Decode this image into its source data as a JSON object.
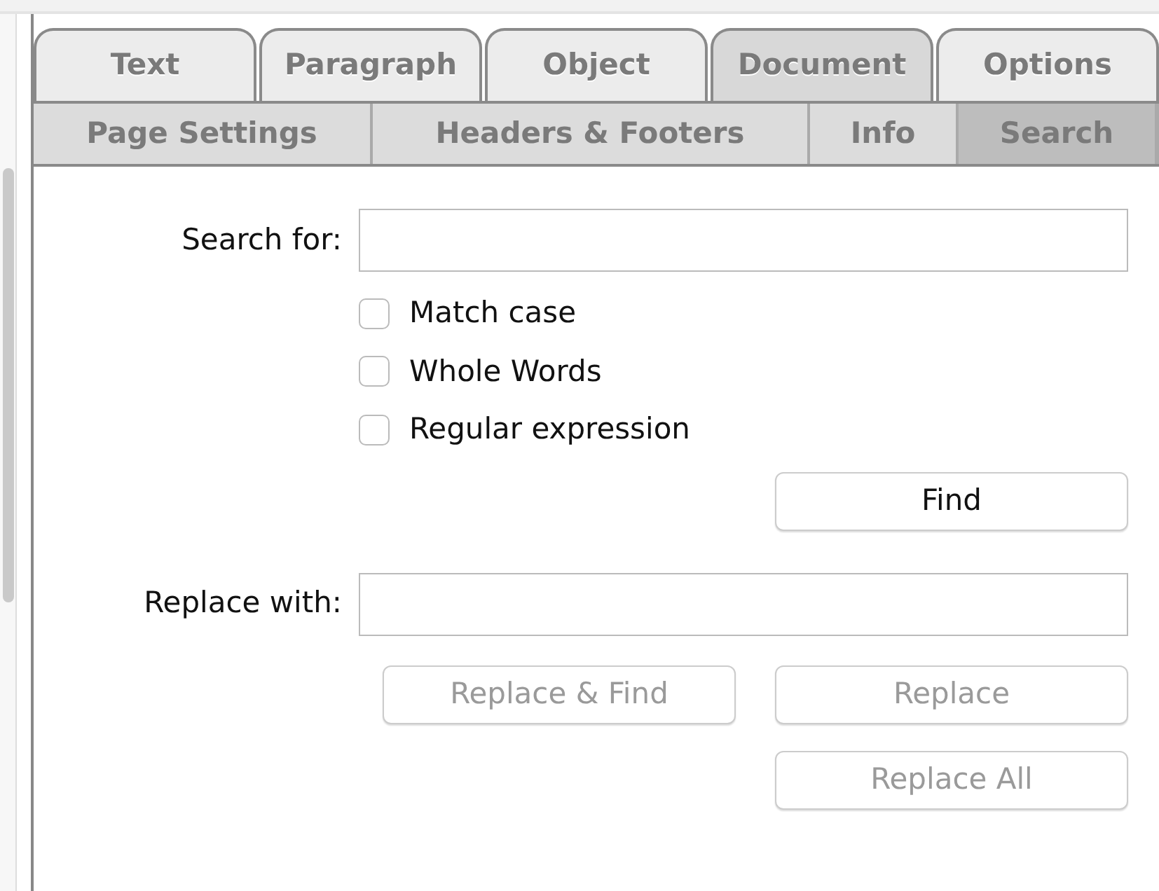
{
  "tabs": [
    {
      "label": "Text",
      "selected": false
    },
    {
      "label": "Paragraph",
      "selected": false
    },
    {
      "label": "Object",
      "selected": false
    },
    {
      "label": "Document",
      "selected": true
    },
    {
      "label": "Options",
      "selected": false
    }
  ],
  "subtabs": [
    {
      "label": "Page Settings",
      "selected": false
    },
    {
      "label": "Headers & Footers",
      "selected": false
    },
    {
      "label": "Info",
      "selected": false
    },
    {
      "label": "Search",
      "selected": true
    }
  ],
  "search": {
    "label": "Search for:"
  },
  "options": [
    {
      "label": "Match case",
      "checked": false
    },
    {
      "label": "Whole Words",
      "checked": false
    },
    {
      "label": "Regular expression",
      "checked": false
    }
  ],
  "find_button": {
    "label": "Find",
    "disabled": false
  },
  "replace": {
    "label": "Replace with:"
  },
  "replace_buttons": [
    {
      "label": "Replace & Find",
      "disabled": true
    },
    {
      "label": "Replace",
      "disabled": true
    },
    {
      "label": "Replace All",
      "disabled": true
    }
  ]
}
